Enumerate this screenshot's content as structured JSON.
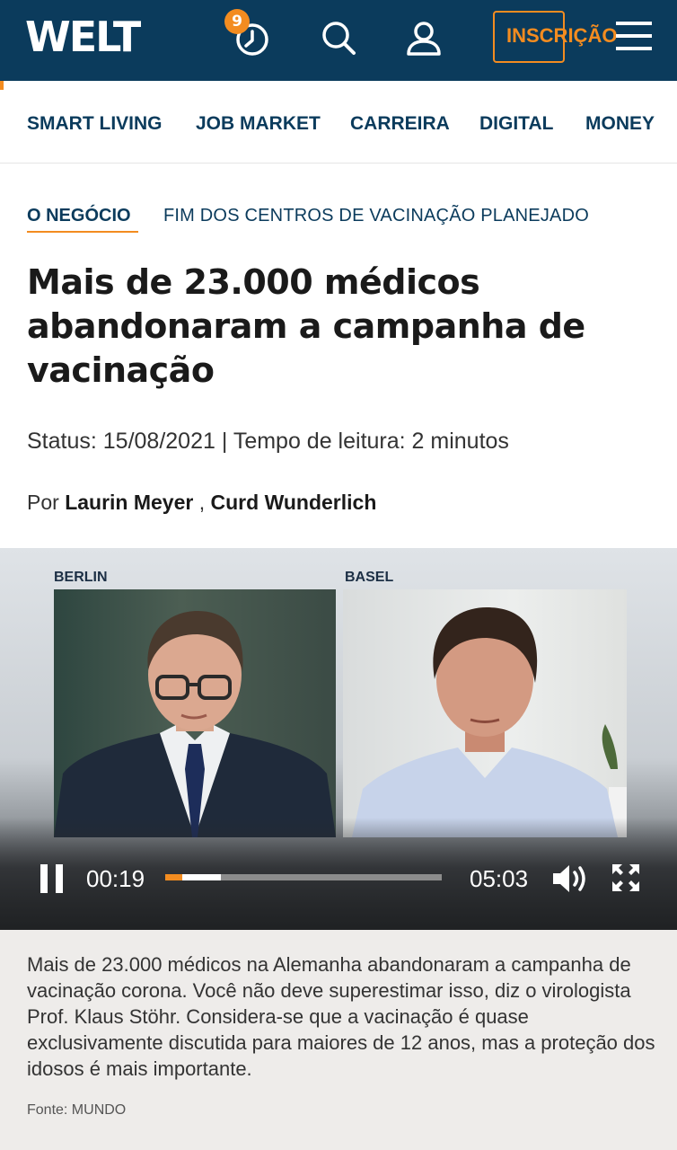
{
  "header": {
    "logo": "WELT",
    "badge_count": "9",
    "subscribe_label": "INSCRIÇÃO"
  },
  "category_nav": [
    {
      "label": "SMART LIVING"
    },
    {
      "label": "JOB MARKET"
    },
    {
      "label": "CARREIRA"
    },
    {
      "label": "DIGITAL"
    },
    {
      "label": "MONEY"
    }
  ],
  "article": {
    "kicker": "O NEGÓCIO",
    "topic": "FIM DOS CENTROS DE VACINAÇÃO PLANEJADO",
    "headline": "Mais de 23.000 médicos abandonaram a campanha de vacinação",
    "meta": "Status: 15/08/2021 | Tempo de leitura: 2 minutos",
    "byline_prefix": "Por",
    "author_1": "Laurin Meyer",
    "author_separator": ",",
    "author_2": "Curd Wunderlich"
  },
  "video": {
    "location_left": "BERLIN",
    "location_right": "BASEL",
    "current_time": "00:19",
    "total_time": "05:03",
    "played_fraction": 0.063,
    "buffered_fraction": 0.2
  },
  "caption": {
    "text": "Mais de 23.000 médicos na Alemanha abandonaram a campanha de vacinação corona. Você não deve superestimar isso, diz o virologista Prof. Klaus Stöhr. Considera-se que a vacinação é quase exclusivamente discutida para maiores de 12 anos, mas a proteção dos idosos é mais importante.",
    "source": "Fonte: MUNDO"
  },
  "colors": {
    "brand_navy": "#0b3b5c",
    "accent_orange": "#f38c20"
  }
}
